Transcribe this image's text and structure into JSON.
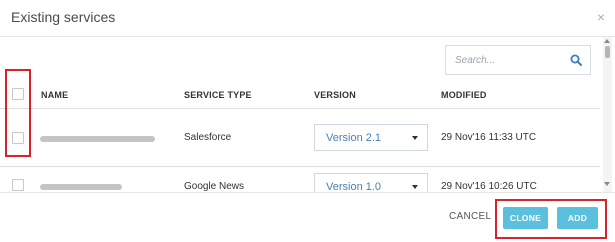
{
  "dialog": {
    "title": "Existing services",
    "close_glyph": "×"
  },
  "search": {
    "placeholder": "Search..."
  },
  "table": {
    "headers": {
      "name": "NAME",
      "service_type": "SERVICE TYPE",
      "version": "VERSION",
      "modified": "MODIFIED"
    },
    "rows": [
      {
        "name": "",
        "service_type": "Salesforce",
        "version": "Version 2.1",
        "modified": "29 Nov'16 11:33 UTC"
      },
      {
        "name": "",
        "service_type": "Google News",
        "version": "Version 1.0",
        "modified": "29 Nov'16 10:26 UTC"
      }
    ]
  },
  "footer": {
    "cancel_label": "CANCEL",
    "clone_label": "CLONE",
    "add_label": "ADD"
  },
  "colors": {
    "accent": "#5bc0de",
    "version_text": "#4a7fb3",
    "highlight": "#d8232a"
  },
  "icons": [
    "close-icon",
    "search-icon",
    "chevron-down-icon"
  ]
}
